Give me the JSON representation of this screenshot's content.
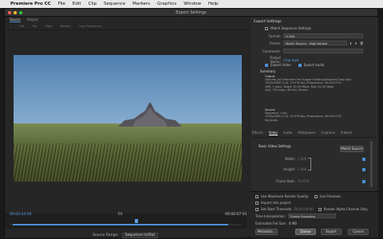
{
  "menubar": {
    "apple": "",
    "app": "Premiere Pro CC",
    "items": [
      "File",
      "Edit",
      "Clip",
      "Sequence",
      "Markers",
      "Graphics",
      "Window",
      "Help"
    ]
  },
  "dialog": {
    "title": "Export Settings"
  },
  "left": {
    "tabs": [
      "Source",
      "Output"
    ],
    "crop": [
      "Left",
      "Top",
      "Right",
      "Bottom",
      "Crop Proportions"
    ],
    "tc_in": "00:00:44:00",
    "tc_out": "00:00:07:01",
    "fit": "Fit",
    "source_range_label": "Source Range:",
    "source_range_value": "Sequence In/Out"
  },
  "export": {
    "heading": "Export Settings",
    "match_seq": "Match Sequence Settings",
    "format_label": "Format:",
    "format": "H.264",
    "preset_label": "Preset:",
    "preset": "Match Source - High bitrate",
    "comments_label": "Comments:",
    "output_label": "Output Name:",
    "output": "Crop.mp4",
    "export_video": "Export Video",
    "export_audio": "Export Audio",
    "summary_heading": "Summary",
    "output_sum_label": "Output:",
    "output_lines": [
      "/Volume_b/X Premiere Pro Support Settings/Exports/Crop.mp4",
      "1920x1080 (1.0), 23.976 fps, Progressive, 00:00:07:01",
      "VBR, 1 pass, Target 10.00 Mbps, Max 12.00 Mbps",
      "AAC, 320 kbps, 48 kHz, Stereo"
    ],
    "source_sum_label": "Source:",
    "source_lines": [
      "Sequence, Crop",
      "1920x1080 (1.0), 23.976 fps, Progressive, 00:00:07:01",
      "No Audio"
    ]
  },
  "right_tabs": [
    "Effects",
    "Video",
    "Audio",
    "Multiplexer",
    "Captions",
    "Publish"
  ],
  "video": {
    "heading": "Basic Video Settings",
    "match_source": "Match Source",
    "width_label": "Width:",
    "width": "1,920",
    "height_label": "Height:",
    "height": "1,080",
    "frame_rate_label": "Frame Rate:",
    "frame_rate": "23.976"
  },
  "lower": {
    "max_render": "Use Maximum Render Quality",
    "use_previews": "Use Previews",
    "import_project": "Import into project",
    "set_start_tc": "Set Start Timecode",
    "start_tc": "00:00:00:00",
    "render_alpha": "Render Alpha Channel Only",
    "time_interp_label": "Time Interpolation:",
    "time_interp": "Frame Sampling",
    "file_size_label": "Estimated File Size:",
    "file_size": "8 MB",
    "metadata": "Metadata...",
    "queue": "Queue",
    "export": "Export",
    "cancel": "Cancel"
  }
}
